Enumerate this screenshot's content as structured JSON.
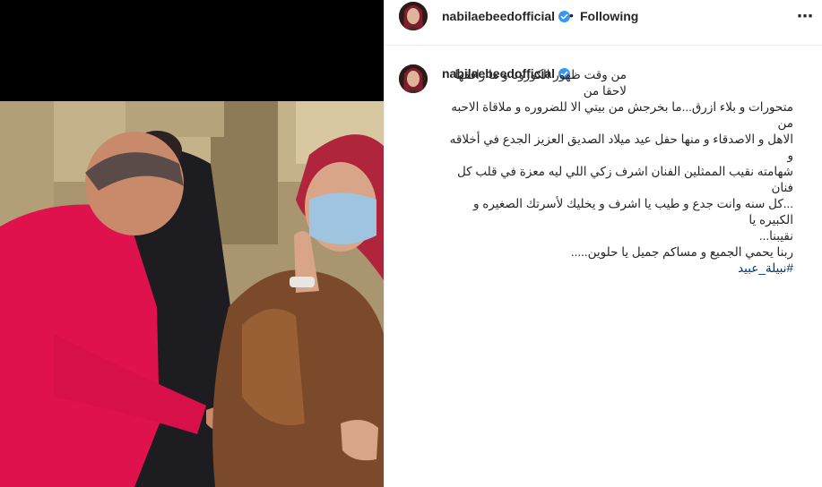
{
  "header": {
    "username": "nabilaebeedofficial",
    "separator": "•",
    "follow_status": "Following",
    "more_icon": "⋯"
  },
  "caption": {
    "username": "nabilaebeedofficial",
    "line1": "من وقت ظهور الكورونا و ما رافقها لاحقا من",
    "line2": "متحورات و بلاء ازرق...ما بخرجش من بيتي الا للضروره و ملاقاة الاحبه من",
    "line3": "الاهل و الاصدقاء و منها حفل عيد ميلاد الصديق العزيز الجدع في أخلاقه و",
    "line4": "شهامته نقيب الممثلين الفنان اشرف زكي اللي ليه معزة في قلب كل فنان",
    "line5": "...كل سنه وانت جدع و طيب يا اشرف و يخليك لأسرتك الصغيره و الكبيره يا",
    "line6": "نقيبنا...",
    "line7": "ربنا يحمي الجميع و مساكم جميل يا حلوين.....",
    "hashtag": "#نبيلة_عبيد"
  },
  "colors": {
    "verified": "#3897f0",
    "hashtag": "#00376b",
    "text": "#262626",
    "divider": "#efefef"
  },
  "icons": [
    "verified-badge-icon",
    "more-options-icon",
    "profile-avatar"
  ]
}
